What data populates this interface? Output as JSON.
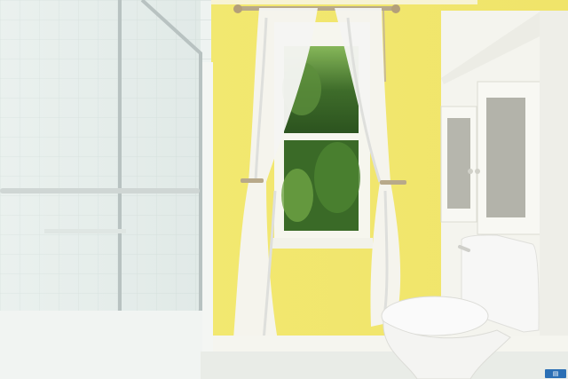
{
  "scene": {
    "description_icon": "photo",
    "colors": {
      "wall": "#f1e870",
      "wall_shadow": "#d8cf55",
      "tile": "#eef3f1",
      "tile_grout": "#cfdad6",
      "glass_frame": "#b9c2c2",
      "curtain": "#f4f4f2",
      "window_trim": "#f7f7ef",
      "trees_dark": "#2f5a22",
      "trees_light": "#7fb24d",
      "toilet": "#f7f7f6",
      "cabinet": "#f4f4ef",
      "floor": "#e9ece7"
    }
  }
}
